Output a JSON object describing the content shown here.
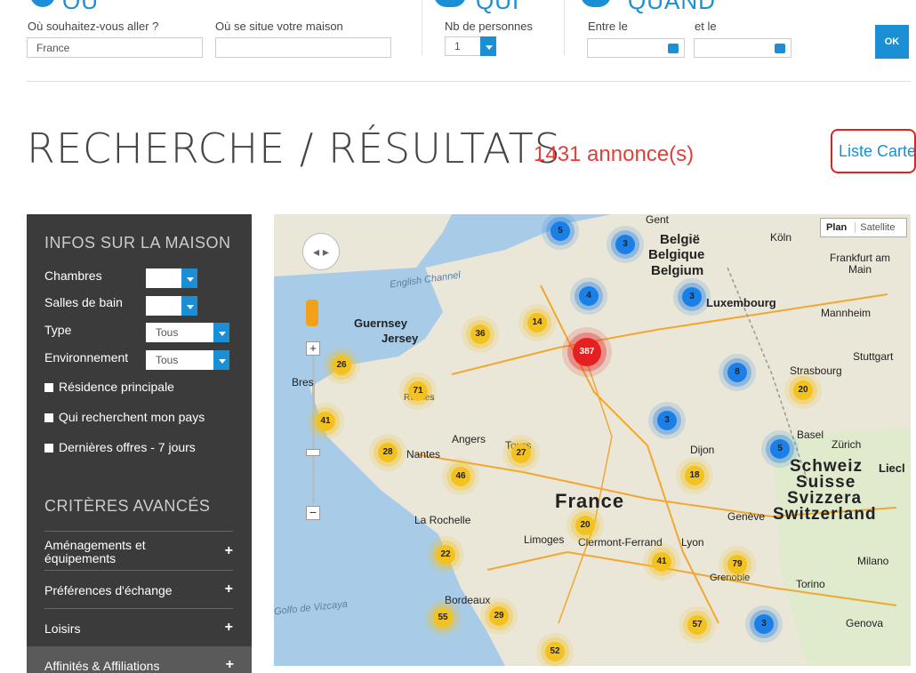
{
  "search_bar": {
    "ou_heading": "OÙ",
    "qui_heading": "QUI",
    "quand_heading": "QUAND",
    "destination_label": "Où souhaitez-vous aller ?",
    "destination_value": "France",
    "home_label": "Où se situe votre maison",
    "home_value": "",
    "people_label": "Nb de personnes",
    "people_value": "1",
    "between_label": "Entre le",
    "and_label": "et le",
    "ok_label": "OK"
  },
  "results": {
    "title": "RECHERCHE / RÉSULTATS",
    "count": "1431 annonce(s)",
    "view_list": "Liste",
    "view_map": "Carte"
  },
  "sidebar": {
    "infos_heading": "INFOS SUR LA MAISON",
    "chambres_label": "Chambres",
    "salles_label": "Salles de bain",
    "type_label": "Type",
    "type_value": "Tous",
    "env_label": "Environnement",
    "env_value": "Tous",
    "check_residence": "Résidence principale",
    "check_pays": "Qui recherchent mon pays",
    "check_offres": "Dernières offres - 7 jours",
    "advanced_heading": "CRITÈRES AVANCÉS",
    "acc_amenagements": "Aménagements et équipements",
    "acc_preferences": "Préférences d'échange",
    "acc_loisirs": "Loisirs",
    "acc_affinites": "Affinités & Affiliations"
  },
  "map": {
    "type_plan": "Plan",
    "type_satellite": "Satellite",
    "labels": {
      "gent": "Gent",
      "koln": "Köln",
      "belgie": "België",
      "belgique": "Belgique",
      "belgium": "Belgium",
      "frankfurt": "Frankfurt am Main",
      "luxembourg": "Luxembourg",
      "english_channel": "English Channel",
      "mannheim": "Mannheim",
      "guernsey": "Guernsey",
      "jersey": "Jersey",
      "stuttgart": "Stuttgart",
      "strasbourg": "Strasbourg",
      "brest": "Bres",
      "rennes": "Rennes",
      "basel": "Basel",
      "zurich": "Zürich",
      "angers": "Angers",
      "tours": "Tours",
      "nantes": "Nantes",
      "dijon": "Dijon",
      "schweiz": "Schweiz",
      "suisse": "Suisse",
      "svizzera": "Svizzera",
      "switzerland": "Switzerland",
      "liecht": "Liecl",
      "france": "France",
      "la_rochelle": "La Rochelle",
      "limoges": "Limoges",
      "clermont": "Clermont-Ferrand",
      "lyon": "Lyon",
      "geneve": "Genève",
      "milano": "Milano",
      "grenoble": "Grenoble",
      "torino": "Torino",
      "vizcaya": "Golfo de Vizcaya",
      "bordeaux": "Bordeaux",
      "genova": "Genova"
    },
    "clusters": {
      "c5a": "5",
      "c3a": "3",
      "c4": "4",
      "c3b": "3",
      "c14": "14",
      "c36": "36",
      "c387": "387",
      "c26": "26",
      "c8": "8",
      "c20a": "20",
      "c71": "71",
      "c41a": "41",
      "c3c": "3",
      "c28": "28",
      "c27": "27",
      "c5b": "5",
      "c46": "46",
      "c18": "18",
      "c20b": "20",
      "c22": "22",
      "c41b": "41",
      "c79": "79",
      "c55": "55",
      "c29": "29",
      "c57": "57",
      "c3d": "3",
      "c52": "52"
    }
  }
}
